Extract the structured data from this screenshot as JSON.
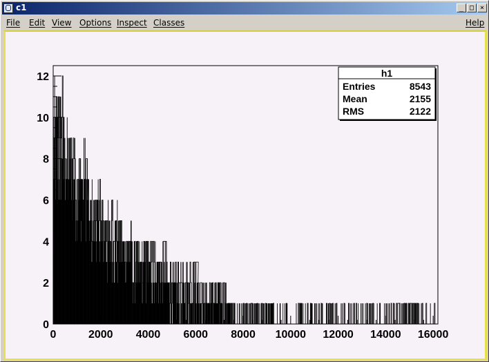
{
  "window": {
    "title": "c1",
    "buttons": [
      "_",
      "□",
      "×"
    ]
  },
  "menu": {
    "items": [
      "File",
      "Edit",
      "View",
      "Options",
      "Inspect",
      "Classes"
    ],
    "help": "Help"
  },
  "stats": {
    "title": "h1",
    "rows": [
      {
        "label": "Entries",
        "value": "8543"
      },
      {
        "label": "Mean",
        "value": "2155"
      },
      {
        "label": "RMS",
        "value": "2122"
      }
    ]
  },
  "chart_data": {
    "type": "bar",
    "title": "",
    "xlabel": "",
    "ylabel": "",
    "xlim": [
      0,
      16200
    ],
    "ylim": [
      0,
      12.5
    ],
    "xticks": [
      "0",
      "2000",
      "4000",
      "6000",
      "8000",
      "10000",
      "12000",
      "14000",
      "16000"
    ],
    "yticks": [
      "0",
      "2",
      "4",
      "6",
      "8",
      "10",
      "12"
    ],
    "bin_width": 16,
    "envelope": [
      {
        "x0": 0,
        "x1": 400,
        "min": 5,
        "max": 12
      },
      {
        "x0": 400,
        "x1": 900,
        "min": 5,
        "max": 10
      },
      {
        "x0": 900,
        "x1": 1450,
        "min": 4,
        "max": 9
      },
      {
        "x0": 1450,
        "x1": 2000,
        "min": 3,
        "max": 7
      },
      {
        "x0": 2000,
        "x1": 2700,
        "min": 2,
        "max": 6
      },
      {
        "x0": 2700,
        "x1": 3300,
        "min": 2,
        "max": 5
      },
      {
        "x0": 3300,
        "x1": 4000,
        "min": 1,
        "max": 4
      },
      {
        "x0": 4000,
        "x1": 4800,
        "min": 1,
        "max": 4
      },
      {
        "x0": 4800,
        "x1": 6100,
        "min": 0,
        "max": 3
      },
      {
        "x0": 6100,
        "x1": 7400,
        "min": 0,
        "max": 2
      },
      {
        "x0": 7400,
        "x1": 9200,
        "min": 0,
        "max": 1
      },
      {
        "x0": 9200,
        "x1": 16200,
        "min": 0,
        "max": 1
      }
    ]
  }
}
